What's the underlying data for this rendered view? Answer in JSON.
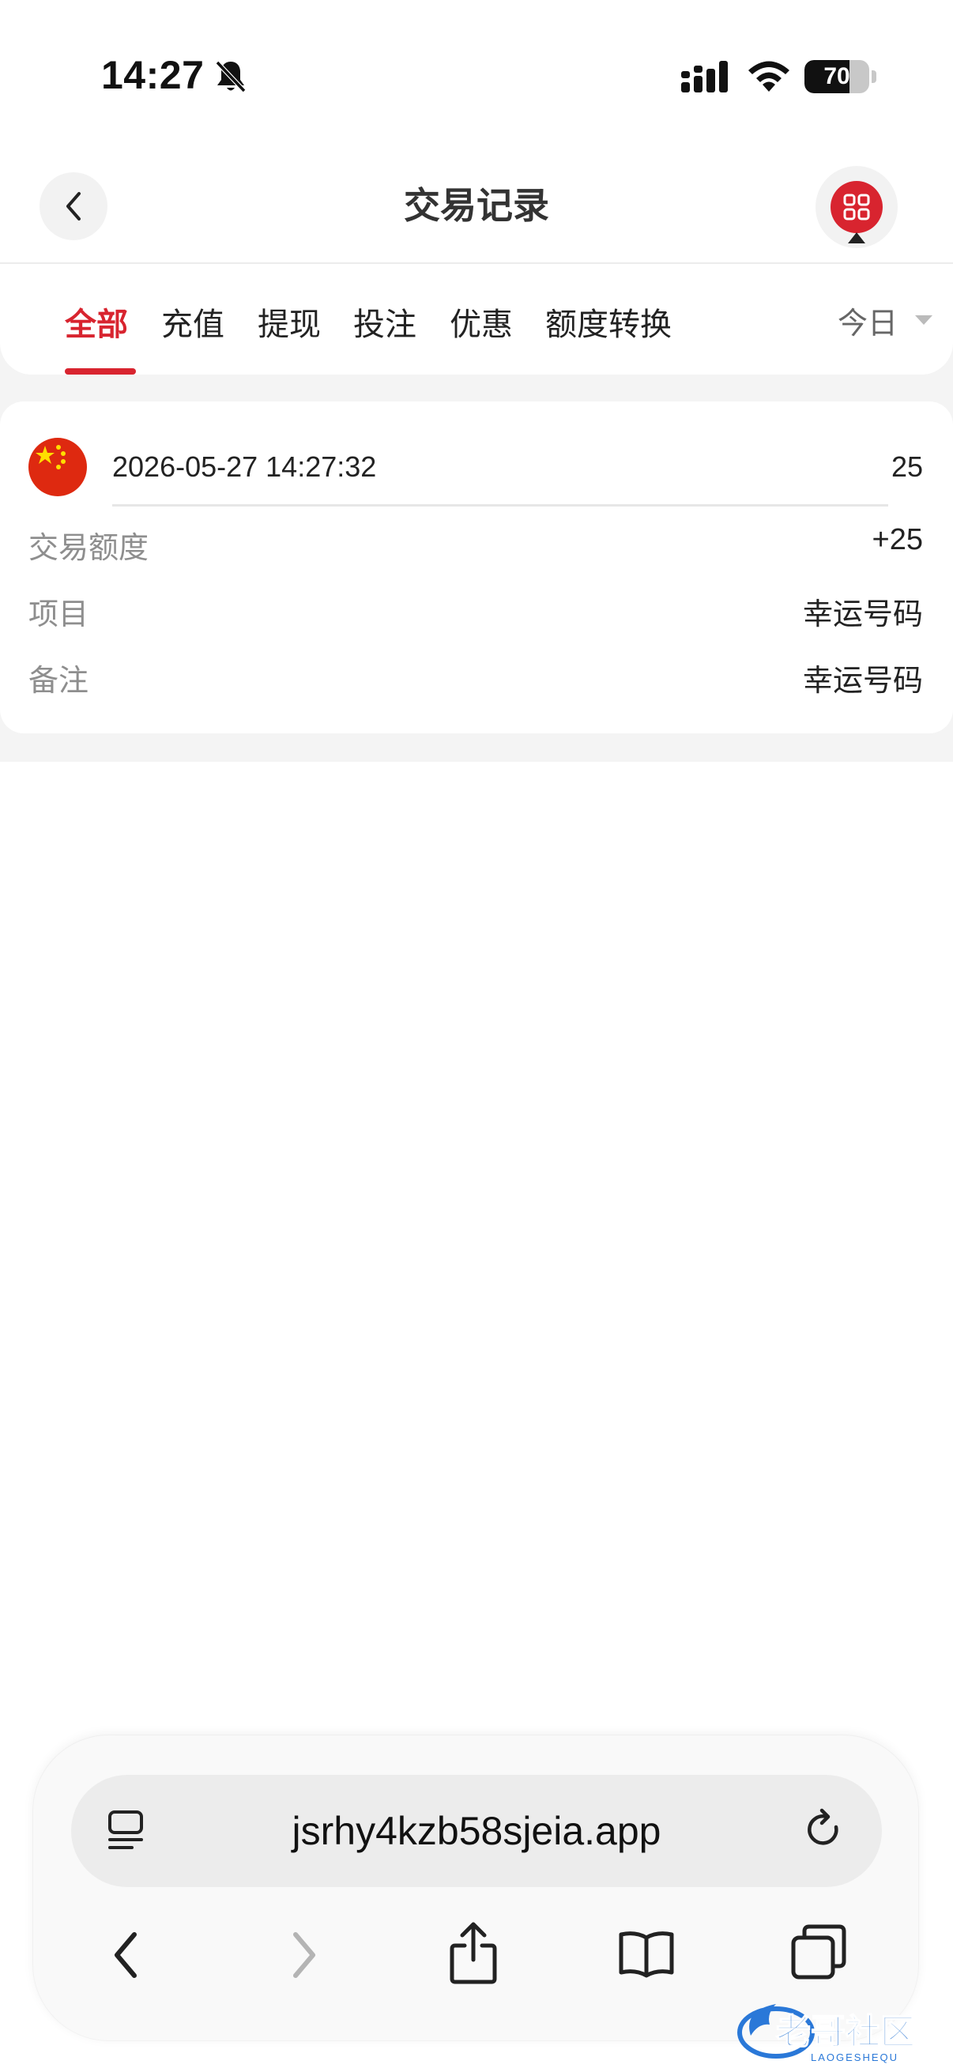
{
  "status_bar": {
    "time": "14:27",
    "battery_level": "70",
    "battery_fraction": 0.7,
    "icons": [
      "bell-slash-icon",
      "cellular-signal-icon",
      "wifi-icon",
      "battery-icon"
    ]
  },
  "header": {
    "title": "交易记录",
    "back_icon": "chevron-left-icon",
    "menu_icon": "grid-menu-icon"
  },
  "tabs": [
    {
      "label": "全部",
      "active": true
    },
    {
      "label": "充值",
      "active": false
    },
    {
      "label": "提现",
      "active": false
    },
    {
      "label": "投注",
      "active": false
    },
    {
      "label": "优惠",
      "active": false
    },
    {
      "label": "额度转换",
      "active": false
    }
  ],
  "filter": {
    "selected": "今日"
  },
  "records": [
    {
      "avatar": "china-flag-icon",
      "time": "2026-05-27 14:27:32",
      "amount": "25",
      "fields": [
        {
          "label": "交易额度",
          "value": "+25"
        },
        {
          "label": "项目",
          "value": "幸运号码"
        },
        {
          "label": "备注",
          "value": "幸运号码"
        }
      ]
    }
  ],
  "browser": {
    "url": "jsrhy4kzb58sjeia.app",
    "toolbar_icons": [
      "back-arrow-icon",
      "forward-arrow-icon",
      "share-icon",
      "bookmarks-icon",
      "tabs-icon"
    ]
  },
  "watermark": {
    "text": "老哥社区",
    "subtext": "LAOGESHEQU"
  },
  "colors": {
    "accent": "#d8242f",
    "text": "#222222",
    "muted": "#8e8e8e",
    "background": "#f4f4f4"
  }
}
